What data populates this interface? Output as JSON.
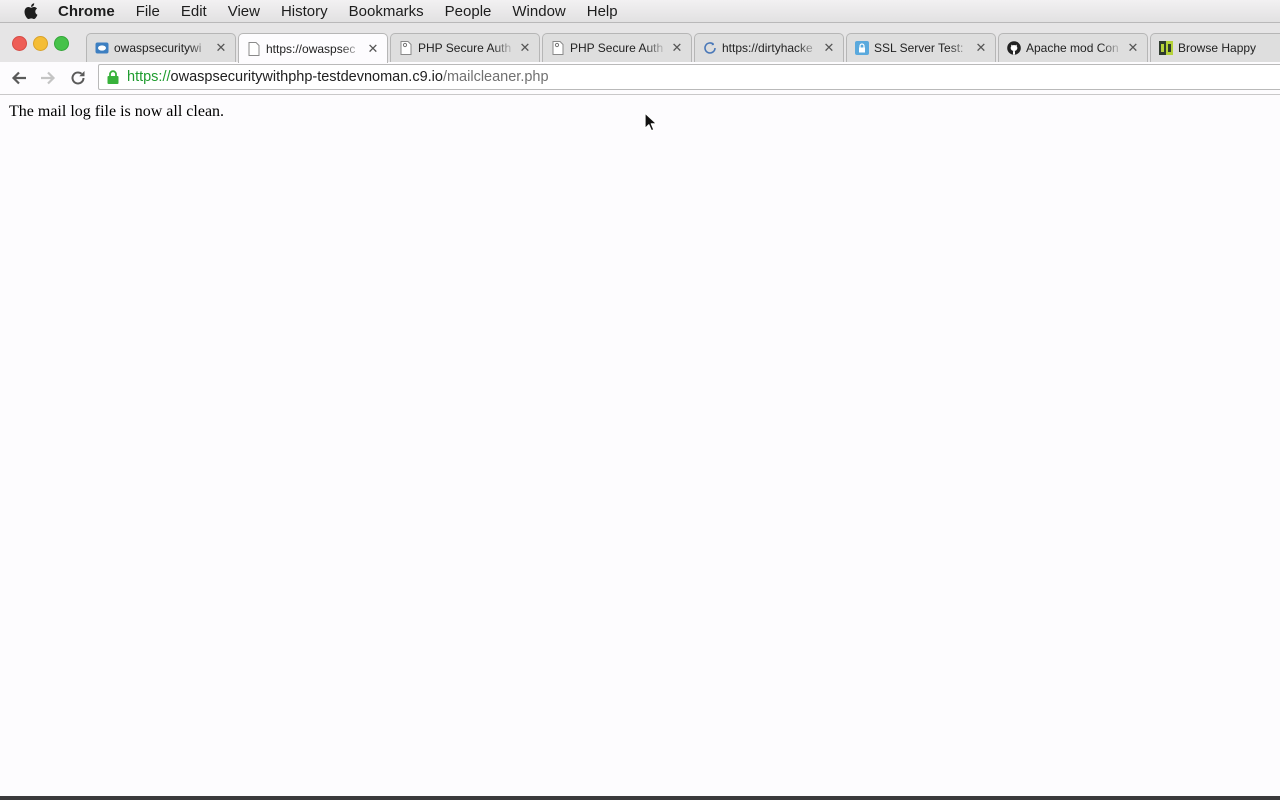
{
  "menubar": {
    "app_name": "Chrome",
    "items": [
      "File",
      "Edit",
      "View",
      "History",
      "Bookmarks",
      "People",
      "Window",
      "Help"
    ]
  },
  "tabs": [
    {
      "title": "owaspsecuritywi",
      "icon": "cloud9-icon",
      "active": false
    },
    {
      "title": "https://owaspsec",
      "icon": "page-icon",
      "active": true
    },
    {
      "title": "PHP Secure Auth",
      "icon": "page-icon",
      "active": false
    },
    {
      "title": "PHP Secure Auth",
      "icon": "page-icon",
      "active": false
    },
    {
      "title": "https://dirtyhacke",
      "icon": "loading-icon",
      "active": false
    },
    {
      "title": "SSL Server Test:",
      "icon": "lock-badge-icon",
      "active": false
    },
    {
      "title": "Apache mod Con",
      "icon": "github-icon",
      "active": false
    },
    {
      "title": "Browse Happy",
      "icon": "browsehappy-icon",
      "active": false
    }
  ],
  "address_bar": {
    "scheme": "https://",
    "host": "owaspsecuritywithphp-testdevnoman.c9.io",
    "path": "/mailcleaner.php"
  },
  "page": {
    "message": "The mail log file is now all clean."
  },
  "colors": {
    "secure_green": "#1f9c2f",
    "close_red": "#ee5d56",
    "minimize_yellow": "#f4bd36",
    "maximize_green": "#46c24a"
  }
}
